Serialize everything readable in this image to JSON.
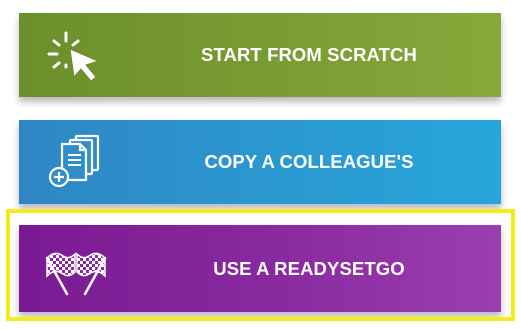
{
  "options": [
    {
      "id": "scratch",
      "label": "START FROM SCRATCH",
      "icon": "sparkle-cursor-icon",
      "color": "#799b33"
    },
    {
      "id": "colleague",
      "label": "COPY A COLLEAGUE'S",
      "icon": "copy-document-add-icon",
      "color": "#2a9ad2"
    },
    {
      "id": "readysetgo",
      "label": "USE A READYSETGO",
      "icon": "checkered-flags-icon",
      "color": "#8a2aa0"
    }
  ],
  "selected_option": "readysetgo",
  "highlight_color": "#f2ec1a"
}
